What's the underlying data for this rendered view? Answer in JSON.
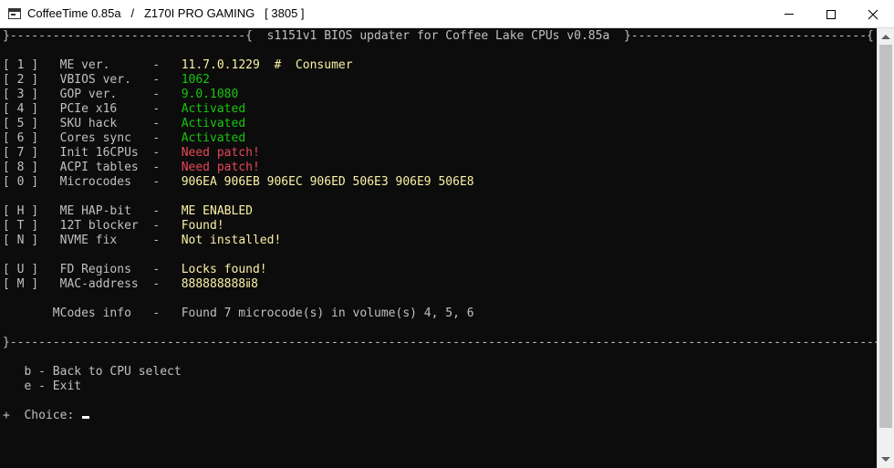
{
  "window": {
    "app_name": "CoffeeTime 0.85a",
    "separator": "/",
    "board": "Z170I PRO GAMING",
    "bios_version": "[ 3805 ]",
    "icon": "console-app-icon",
    "controls": [
      "minimize-icon",
      "maximize-icon",
      "close-icon"
    ]
  },
  "console": {
    "header_line": "}---------------------------------{  s1151v1 BIOS updater for Coffee Lake CPUs v0.85a  }---------------------------------{",
    "menu": [
      {
        "key": "[ 1 ]",
        "label": "ME ver.",
        "sep": "-",
        "value": "11.7.0.1229",
        "value_color": "yellow",
        "extra": "  #  Consumer"
      },
      {
        "key": "[ 2 ]",
        "label": "VBIOS ver.",
        "sep": "-",
        "value": "1062",
        "value_color": "green"
      },
      {
        "key": "[ 3 ]",
        "label": "GOP ver.",
        "sep": "-",
        "value": "9.0.1080",
        "value_color": "green"
      },
      {
        "key": "[ 4 ]",
        "label": "PCIe x16",
        "sep": "-",
        "value": "Activated",
        "value_color": "green"
      },
      {
        "key": "[ 5 ]",
        "label": "SKU hack",
        "sep": "-",
        "value": "Activated",
        "value_color": "green"
      },
      {
        "key": "[ 6 ]",
        "label": "Cores sync",
        "sep": "-",
        "value": "Activated",
        "value_color": "green"
      },
      {
        "key": "[ 7 ]",
        "label": "Init 16CPUs",
        "sep": "-",
        "value": "Need patch!",
        "value_color": "red"
      },
      {
        "key": "[ 8 ]",
        "label": "ACPI tables",
        "sep": "-",
        "value": "Need patch!",
        "value_color": "red"
      },
      {
        "key": "[ 0 ]",
        "label": "Microcodes",
        "sep": "-",
        "value": "906EA 906EB 906EC 906ED 506E3 906E9 506E8",
        "value_color": "yellow"
      },
      {
        "key": "[ H ]",
        "label": "ME HAP-bit",
        "sep": "-",
        "value": "ME ENABLED",
        "value_color": "yellow"
      },
      {
        "key": "[ T ]",
        "label": "12T blocker",
        "sep": "-",
        "value": "Found!",
        "value_color": "yellow"
      },
      {
        "key": "[ N ]",
        "label": "NVME fix",
        "sep": "-",
        "value": "Not installed!",
        "value_color": "yellow"
      },
      {
        "key": "[ U ]",
        "label": "FD Regions",
        "sep": "-",
        "value": "Locks found!",
        "value_color": "yellow"
      },
      {
        "key": "[ M ]",
        "label": "MAC-address",
        "sep": "-",
        "value": "888888888ⅱ8",
        "value_color": "yellow"
      },
      {
        "key": "",
        "label": "MCodes info",
        "sep": "-",
        "value": "Found 7 microcode(s) in volume(s) 4, 5, 6",
        "value_color": "gray"
      }
    ],
    "footer_line": "}-------------------------------------------------------------------------------------------------------------------------{",
    "options": [
      "b - Back to CPU select",
      "e - Exit"
    ],
    "prompt_prefix": "+",
    "prompt": "Choice:"
  },
  "colors": {
    "background": "#0c0c0c",
    "default_text": "#c0c0c0",
    "yellow": "#f9f1a5",
    "green": "#16c60c",
    "red": "#e74856"
  }
}
